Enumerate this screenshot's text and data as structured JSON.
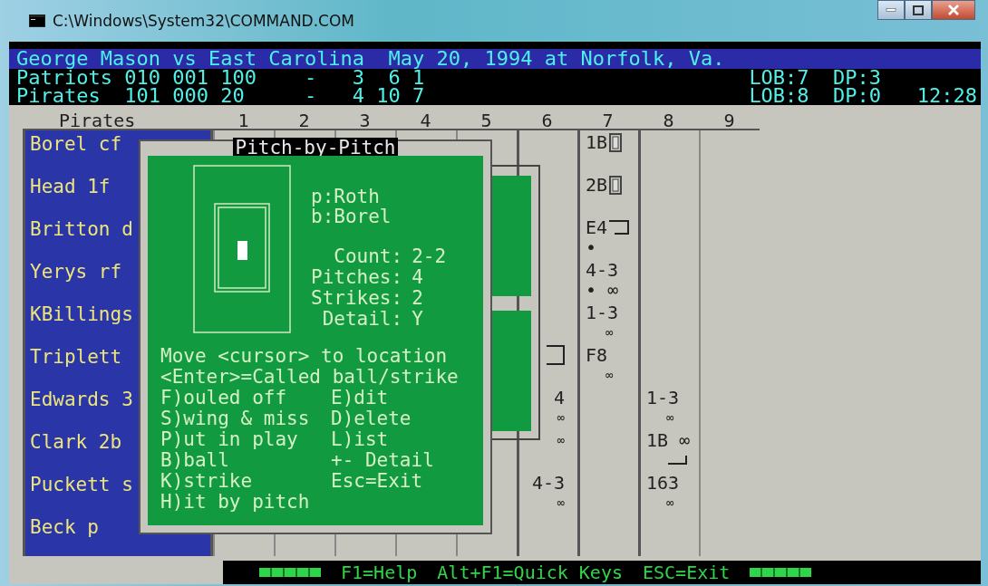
{
  "window": {
    "title": "C:\\Windows\\System32\\COMMAND.COM"
  },
  "game": {
    "heading": "George Mason vs East Carolina  May 20, 1994 at Norfolk, Va.",
    "teams": [
      {
        "name": "Patriots",
        "line_score": "010 001 100",
        "dash": "-",
        "runs": "3",
        "hits": "6",
        "errors": "1",
        "lob": "LOB:7",
        "dp": "DP:3"
      },
      {
        "name": "Pirates",
        "line_score": "101 000 20",
        "dash": "-",
        "runs": "4",
        "hits": "10",
        "errors": "7",
        "lob": "LOB:8",
        "dp": "DP:0",
        "time": "12:28"
      }
    ]
  },
  "scoresheet": {
    "team": "Pirates",
    "innings": [
      "1",
      "2",
      "3",
      "4",
      "5",
      "6",
      "7",
      "8",
      "9"
    ],
    "players": [
      {
        "name": "Borel cf",
        "innings": [
          {
            "kind": "blank"
          },
          {
            "kind": "blank"
          },
          {
            "kind": "blank"
          },
          {
            "kind": "blank"
          },
          {
            "kind": "blank"
          },
          {
            "kind": "blank"
          },
          {
            "kind": "play",
            "lines": [
              {
                "kind": "base",
                "text": "1B"
              }
            ]
          },
          {
            "kind": "blank"
          },
          {
            "kind": "blank"
          }
        ]
      },
      {
        "name": "Head 1f",
        "innings": [
          {
            "kind": "blank"
          },
          {
            "kind": "blank"
          },
          {
            "kind": "blank"
          },
          {
            "kind": "blank"
          },
          {
            "kind": "blank"
          },
          {
            "kind": "blank"
          },
          {
            "kind": "play",
            "lines": [
              {
                "kind": "base",
                "text": "2B"
              }
            ]
          },
          {
            "kind": "blank"
          },
          {
            "kind": "blank"
          }
        ]
      },
      {
        "name": "Britton d",
        "innings": [
          {
            "kind": "blank"
          },
          {
            "kind": "blank"
          },
          {
            "kind": "blank"
          },
          {
            "kind": "blank"
          },
          {
            "kind": "blank"
          },
          {
            "kind": "blank"
          },
          {
            "kind": "play",
            "lines": [
              {
                "kind": "bracket",
                "text": "E4"
              },
              {
                "kind": "plain",
                "text": "•"
              }
            ]
          },
          {
            "kind": "blank"
          },
          {
            "kind": "blank"
          }
        ]
      },
      {
        "name": "Yerys rf",
        "innings": [
          {
            "kind": "blank"
          },
          {
            "kind": "blank"
          },
          {
            "kind": "blank"
          },
          {
            "kind": "blank"
          },
          {
            "kind": "blank"
          },
          {
            "kind": "blank"
          },
          {
            "kind": "play",
            "lines": [
              {
                "kind": "plain",
                "text": "4-3"
              },
              {
                "kind": "plain",
                "text": "• ∞"
              }
            ]
          },
          {
            "kind": "blank"
          },
          {
            "kind": "blank"
          }
        ]
      },
      {
        "name": "KBillings",
        "innings": [
          {
            "kind": "blank"
          },
          {
            "kind": "blank"
          },
          {
            "kind": "blank"
          },
          {
            "kind": "blank"
          },
          {
            "kind": "blank"
          },
          {
            "kind": "blank"
          },
          {
            "kind": "play",
            "lines": [
              {
                "kind": "plain",
                "text": "1-3"
              },
              {
                "kind": "small",
                "text": "∞"
              }
            ]
          },
          {
            "kind": "blank"
          },
          {
            "kind": "blank"
          }
        ]
      },
      {
        "name": "Triplett",
        "innings": [
          {
            "kind": "blank"
          },
          {
            "kind": "blank"
          },
          {
            "kind": "blank"
          },
          {
            "kind": "blank"
          },
          {
            "kind": "blank"
          },
          {
            "kind": "play",
            "lines": [
              {
                "kind": "bracket"
              }
            ]
          },
          {
            "kind": "play",
            "lines": [
              {
                "kind": "plain",
                "text": "F8"
              },
              {
                "kind": "small",
                "text": "∞"
              }
            ]
          },
          {
            "kind": "blank"
          },
          {
            "kind": "blank"
          }
        ]
      },
      {
        "name": "Edwards 3",
        "innings": [
          {
            "kind": "blank"
          },
          {
            "kind": "blank"
          },
          {
            "kind": "blank"
          },
          {
            "kind": "blank"
          },
          {
            "kind": "blank"
          },
          {
            "kind": "play",
            "lines": [
              {
                "kind": "plain",
                "text": "4"
              },
              {
                "kind": "small",
                "text": "∞"
              }
            ]
          },
          {
            "kind": "blank"
          },
          {
            "kind": "play",
            "lines": [
              {
                "kind": "plain",
                "text": "1-3"
              },
              {
                "kind": "small",
                "text": "∞"
              }
            ]
          },
          {
            "kind": "blank"
          }
        ]
      },
      {
        "name": "Clark 2b",
        "innings": [
          {
            "kind": "blank"
          },
          {
            "kind": "blank"
          },
          {
            "kind": "blank"
          },
          {
            "kind": "blank"
          },
          {
            "kind": "blank"
          },
          {
            "kind": "play",
            "lines": [
              {
                "kind": "small",
                "text": "∞"
              }
            ]
          },
          {
            "kind": "blank"
          },
          {
            "kind": "play",
            "lines": [
              {
                "kind": "corner",
                "text": "1B ∞"
              }
            ]
          },
          {
            "kind": "blank"
          }
        ]
      },
      {
        "name": "Puckett s",
        "innings": [
          {
            "kind": "blank"
          },
          {
            "kind": "blank"
          },
          {
            "kind": "blank"
          },
          {
            "kind": "blank"
          },
          {
            "kind": "blank"
          },
          {
            "kind": "play",
            "lines": [
              {
                "kind": "plain",
                "text": "4-3"
              },
              {
                "kind": "small",
                "text": "∞"
              }
            ]
          },
          {
            "kind": "blank"
          },
          {
            "kind": "play",
            "lines": [
              {
                "kind": "plain",
                "text": "163"
              },
              {
                "kind": "small",
                "text": "∞"
              }
            ]
          },
          {
            "kind": "blank"
          }
        ]
      },
      {
        "name": "Beck p",
        "innings": [
          {
            "kind": "blank"
          },
          {
            "kind": "blank"
          },
          {
            "kind": "blank"
          },
          {
            "kind": "blank"
          },
          {
            "kind": "blank"
          },
          {
            "kind": "blank"
          },
          {
            "kind": "blank"
          },
          {
            "kind": "blank"
          },
          {
            "kind": "blank"
          }
        ]
      }
    ]
  },
  "popup": {
    "title": "Pitch-by-Pitch",
    "pitcher": "p:Roth",
    "batter": "b:Borel",
    "stats": [
      {
        "label": "Count:",
        "value": "2-2"
      },
      {
        "label": "Pitches:",
        "value": "4"
      },
      {
        "label": "Strikes:",
        "value": "2"
      },
      {
        "label": "Detail:",
        "value": "Y"
      }
    ],
    "instructions": [
      "Move <cursor> to location",
      "<Enter>=Called ball/strike"
    ],
    "keys": [
      {
        "left": "F)ouled off",
        "right": "E)dit"
      },
      {
        "left": "S)wing & miss",
        "right": "D)elete"
      },
      {
        "left": "P)ut in play",
        "right": "L)ist"
      },
      {
        "left": "B)ball",
        "right": "+- Detail"
      },
      {
        "left": "K)strike",
        "right": "Esc=Exit"
      },
      {
        "left": "H)it by pitch"
      }
    ]
  },
  "status_bar": [
    "F1=Help",
    "Alt+F1=Quick Keys",
    "ESC=Exit"
  ]
}
